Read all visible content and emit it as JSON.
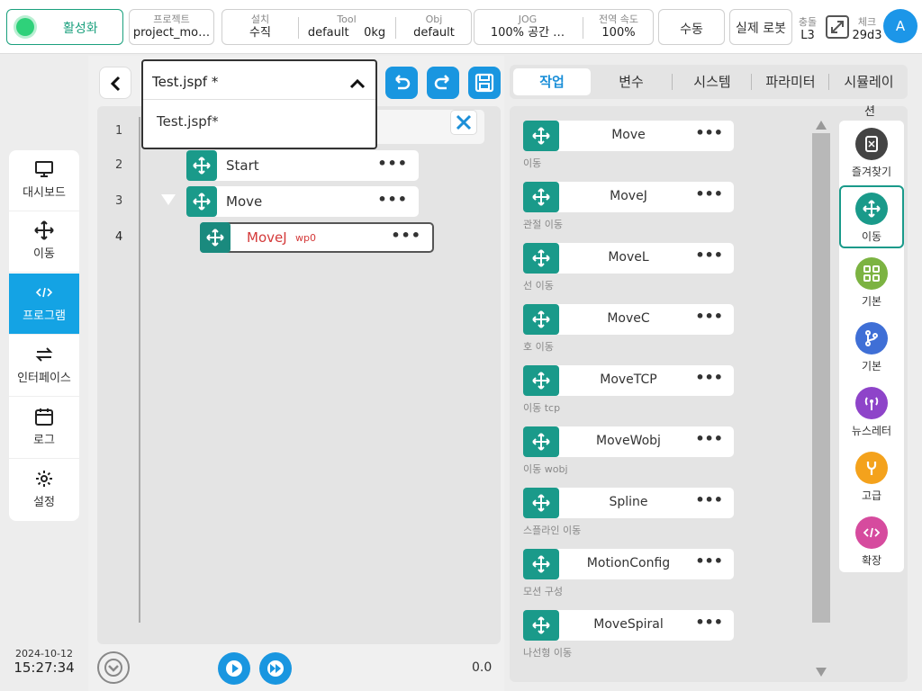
{
  "topbar": {
    "activate_label": "활성화",
    "project": {
      "label": "프로젝트",
      "value": "project_mo…"
    },
    "install": {
      "label": "설치",
      "value": "수직"
    },
    "tool": {
      "label": "Tool",
      "value": "default",
      "weight": "0kg"
    },
    "obj": {
      "label": "Obj",
      "value": "default"
    },
    "jog": {
      "label": "JOG",
      "value": "100%  공간 …"
    },
    "global_speed": {
      "label": "전역 속도",
      "value": "100%"
    },
    "manual_label": "수동",
    "real_robot_label": "실제 로봇",
    "collision": {
      "label": "충돌",
      "value": "L3"
    },
    "check": {
      "label": "체크",
      "value": "29d3"
    },
    "avatar_letter": "A"
  },
  "nav": {
    "items": [
      {
        "label": "대시보드",
        "icon": "monitor-icon"
      },
      {
        "label": "이동",
        "icon": "move-icon"
      },
      {
        "label": "프로그램",
        "icon": "code-icon",
        "active": true
      },
      {
        "label": "인터페이스",
        "icon": "swap-icon"
      },
      {
        "label": "로그",
        "icon": "calendar-icon"
      },
      {
        "label": "설정",
        "icon": "gear-icon"
      }
    ]
  },
  "datetime": {
    "date": "2024-10-12",
    "time": "15:27:34"
  },
  "program": {
    "file_selected": "Test.jspf *",
    "file_options": [
      "Test.jspf*"
    ],
    "lines": [
      "1",
      "2",
      "3",
      "4"
    ],
    "nodes": [
      {
        "label": "Start"
      },
      {
        "label": "Move"
      },
      {
        "label": "MoveJ",
        "tag": "wp0"
      }
    ],
    "progress_value": "0.0"
  },
  "tabs": [
    "작업",
    "변수",
    "시스템",
    "파라미터",
    "시뮬레이"
  ],
  "commands": [
    {
      "name": "Move",
      "desc": "이동"
    },
    {
      "name": "MoveJ",
      "desc": "관절 이동"
    },
    {
      "name": "MoveL",
      "desc": "선 이동"
    },
    {
      "name": "MoveC",
      "desc": "호 이동"
    },
    {
      "name": "MoveTCP",
      "desc": "이동 tcp"
    },
    {
      "name": "MoveWobj",
      "desc": "이동 wobj"
    },
    {
      "name": "Spline",
      "desc": "스플라인 이동"
    },
    {
      "name": "MotionConfig",
      "desc": "모션 구성"
    },
    {
      "name": "MoveSpiral",
      "desc": "나선형 이동"
    }
  ],
  "categories_header": "션",
  "categories": [
    {
      "label": "즐겨찾기",
      "color": "#444444",
      "icon": "bookmark-icon"
    },
    {
      "label": "이동",
      "color": "#1a9a8a",
      "icon": "move-icon",
      "active": true
    },
    {
      "label": "기본",
      "color": "#7cb342",
      "icon": "grid-icon"
    },
    {
      "label": "기본",
      "color": "#3f6fd6",
      "icon": "branch-icon"
    },
    {
      "label": "뉴스레터",
      "color": "#8e44c9",
      "icon": "antenna-icon"
    },
    {
      "label": "고급",
      "color": "#f4a21c",
      "icon": "wrench-icon"
    },
    {
      "label": "확장",
      "color": "#d64b9e",
      "icon": "code-icon"
    }
  ]
}
